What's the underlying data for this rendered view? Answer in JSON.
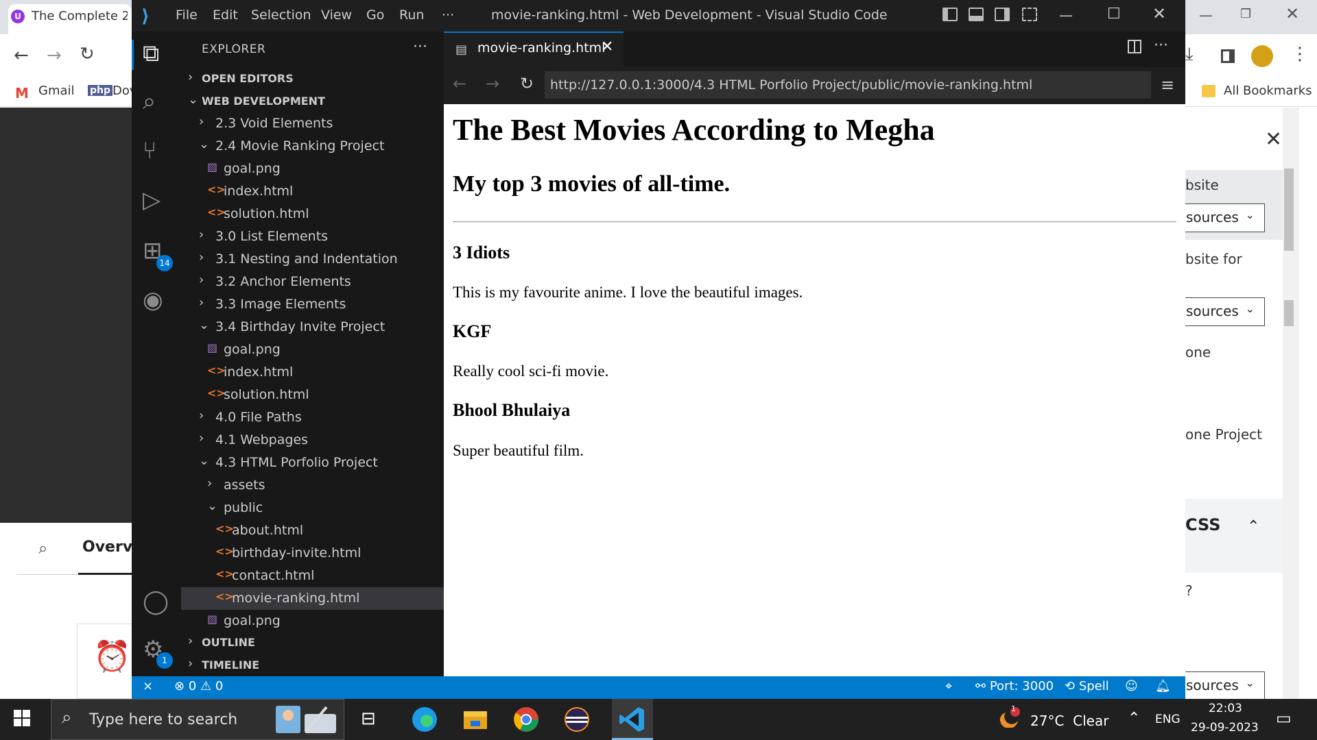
{
  "chrome": {
    "tab_title": "The Complete 2",
    "tab_icon": "U",
    "bookmarks": [
      {
        "label": "Gmail",
        "icon": "gmail-icon"
      },
      {
        "label": "Dov",
        "icon": "php-icon"
      }
    ],
    "php_icon_text": "php",
    "all_bookmarks": "All Bookmarks",
    "overview_label": "Overvi",
    "right_panel": {
      "website": "bsite",
      "button_label": "sources",
      "website_for": "bsite for",
      "one": "one",
      "one_project": "one Project",
      "css": "CSS",
      "question": "?"
    }
  },
  "vscode": {
    "menu": [
      "File",
      "Edit",
      "Selection",
      "View",
      "Go",
      "Run",
      "···"
    ],
    "window_title": "movie-ranking.html - Web Development - Visual Studio Code",
    "activity_badges": {
      "extensions": "14",
      "settings": "1"
    },
    "explorer_title": "EXPLORER",
    "explorer_more": "···",
    "sections": {
      "open_editors": "OPEN EDITORS",
      "workspace": "WEB DEVELOPMENT",
      "outline": "OUTLINE",
      "timeline": "TIMELINE"
    },
    "tree": [
      {
        "label": "2.3 Void Elements",
        "type": "folder",
        "expanded": false,
        "depth": 1
      },
      {
        "label": "2.4 Movie Ranking Project",
        "type": "folder",
        "expanded": true,
        "depth": 1
      },
      {
        "label": "goal.png",
        "type": "png",
        "depth": 2
      },
      {
        "label": "index.html",
        "type": "html",
        "depth": 2
      },
      {
        "label": "solution.html",
        "type": "html",
        "depth": 2
      },
      {
        "label": "3.0 List Elements",
        "type": "folder",
        "expanded": false,
        "depth": 1
      },
      {
        "label": "3.1 Nesting and Indentation",
        "type": "folder",
        "expanded": false,
        "depth": 1
      },
      {
        "label": "3.2 Anchor Elements",
        "type": "folder",
        "expanded": false,
        "depth": 1
      },
      {
        "label": "3.3 Image Elements",
        "type": "folder",
        "expanded": false,
        "depth": 1
      },
      {
        "label": "3.4 Birthday Invite Project",
        "type": "folder",
        "expanded": true,
        "depth": 1
      },
      {
        "label": "goal.png",
        "type": "png",
        "depth": 2
      },
      {
        "label": "index.html",
        "type": "html",
        "depth": 2
      },
      {
        "label": "solution.html",
        "type": "html",
        "depth": 2
      },
      {
        "label": "4.0 File Paths",
        "type": "folder",
        "expanded": false,
        "depth": 1
      },
      {
        "label": "4.1 Webpages",
        "type": "folder",
        "expanded": false,
        "depth": 1
      },
      {
        "label": "4.3 HTML Porfolio Project",
        "type": "folder",
        "expanded": true,
        "depth": 1
      },
      {
        "label": "assets",
        "type": "folder",
        "expanded": false,
        "depth": 2
      },
      {
        "label": "public",
        "type": "folder",
        "expanded": true,
        "depth": 2
      },
      {
        "label": "about.html",
        "type": "html",
        "depth": 3
      },
      {
        "label": "birthday-invite.html",
        "type": "html",
        "depth": 3
      },
      {
        "label": "contact.html",
        "type": "html",
        "depth": 3
      },
      {
        "label": "movie-ranking.html",
        "type": "html",
        "depth": 3,
        "selected": true
      },
      {
        "label": "goal.png",
        "type": "png",
        "depth": 2
      }
    ],
    "editor_tab": "movie-ranking.html",
    "url": "http://127.0.0.1:3000/4.3 HTML Porfolio Project/public/movie-ranking.html",
    "preview": {
      "h1": "The Best Movies According to Megha",
      "h2": "My top 3 movies of all-time.",
      "movies": [
        {
          "title": "3 Idiots",
          "desc": "This is my favourite anime. I love the beautiful images."
        },
        {
          "title": "KGF",
          "desc": "Really cool sci-fi movie."
        },
        {
          "title": "Bhool Bhulaiya",
          "desc": "Super beautiful film."
        }
      ]
    },
    "status": {
      "errors": "0",
      "warnings": "0",
      "port": "Port: 3000",
      "spell": "Spell"
    }
  },
  "taskbar": {
    "search_placeholder": "Type here to search",
    "weather": "27°C  Clear",
    "weather_badge": "1",
    "language": "ENG",
    "time": "22:03",
    "date": "29-09-2023"
  },
  "colors": {
    "vscode_bg": "#1f1f1f",
    "statusbar": "#007acc",
    "accent": "#0078d4"
  }
}
